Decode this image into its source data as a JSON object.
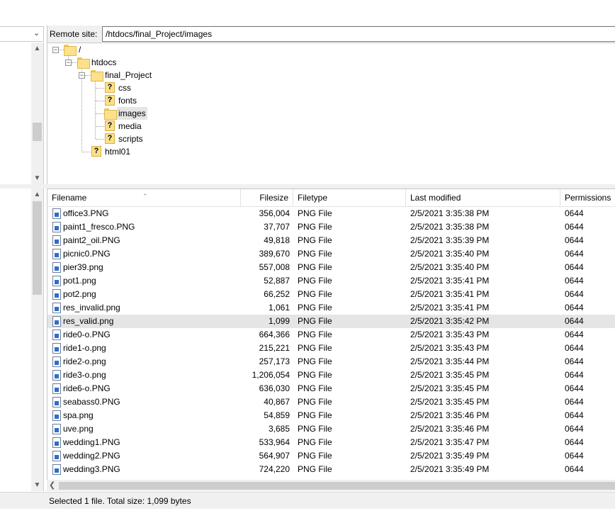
{
  "remote": {
    "label": "Remote site:",
    "path": "/htdocs/final_Project/images"
  },
  "tree": {
    "root": "/",
    "htdocs": "htdocs",
    "final_project": "final_Project",
    "children": [
      "css",
      "fonts",
      "images",
      "media",
      "scripts"
    ],
    "html01": "html01"
  },
  "columns": {
    "filename": "Filename",
    "filesize": "Filesize",
    "filetype": "Filetype",
    "modified": "Last modified",
    "permissions": "Permissions"
  },
  "files": [
    {
      "name": "office3.PNG",
      "size": "356,004",
      "type": "PNG File",
      "modified": "2/5/2021 3:35:38 PM",
      "perm": "0644"
    },
    {
      "name": "paint1_fresco.PNG",
      "size": "37,707",
      "type": "PNG File",
      "modified": "2/5/2021 3:35:38 PM",
      "perm": "0644"
    },
    {
      "name": "paint2_oil.PNG",
      "size": "49,818",
      "type": "PNG File",
      "modified": "2/5/2021 3:35:39 PM",
      "perm": "0644"
    },
    {
      "name": "picnic0.PNG",
      "size": "389,670",
      "type": "PNG File",
      "modified": "2/5/2021 3:35:40 PM",
      "perm": "0644"
    },
    {
      "name": "pier39.png",
      "size": "557,008",
      "type": "PNG File",
      "modified": "2/5/2021 3:35:40 PM",
      "perm": "0644"
    },
    {
      "name": "pot1.png",
      "size": "52,887",
      "type": "PNG File",
      "modified": "2/5/2021 3:35:41 PM",
      "perm": "0644"
    },
    {
      "name": "pot2.png",
      "size": "66,252",
      "type": "PNG File",
      "modified": "2/5/2021 3:35:41 PM",
      "perm": "0644"
    },
    {
      "name": "res_invalid.png",
      "size": "1,061",
      "type": "PNG File",
      "modified": "2/5/2021 3:35:41 PM",
      "perm": "0644"
    },
    {
      "name": "res_valid.png",
      "size": "1,099",
      "type": "PNG File",
      "modified": "2/5/2021 3:35:42 PM",
      "perm": "0644"
    },
    {
      "name": "ride0-o.PNG",
      "size": "664,366",
      "type": "PNG File",
      "modified": "2/5/2021 3:35:43 PM",
      "perm": "0644"
    },
    {
      "name": "ride1-o.png",
      "size": "215,221",
      "type": "PNG File",
      "modified": "2/5/2021 3:35:43 PM",
      "perm": "0644"
    },
    {
      "name": "ride2-o.png",
      "size": "257,173",
      "type": "PNG File",
      "modified": "2/5/2021 3:35:44 PM",
      "perm": "0644"
    },
    {
      "name": "ride3-o.png",
      "size": "1,206,054",
      "type": "PNG File",
      "modified": "2/5/2021 3:35:45 PM",
      "perm": "0644"
    },
    {
      "name": "ride6-o.PNG",
      "size": "636,030",
      "type": "PNG File",
      "modified": "2/5/2021 3:35:45 PM",
      "perm": "0644"
    },
    {
      "name": "seabass0.PNG",
      "size": "40,867",
      "type": "PNG File",
      "modified": "2/5/2021 3:35:45 PM",
      "perm": "0644"
    },
    {
      "name": "spa.png",
      "size": "54,859",
      "type": "PNG File",
      "modified": "2/5/2021 3:35:46 PM",
      "perm": "0644"
    },
    {
      "name": "uve.png",
      "size": "3,685",
      "type": "PNG File",
      "modified": "2/5/2021 3:35:46 PM",
      "perm": "0644"
    },
    {
      "name": "wedding1.PNG",
      "size": "533,964",
      "type": "PNG File",
      "modified": "2/5/2021 3:35:47 PM",
      "perm": "0644"
    },
    {
      "name": "wedding2.PNG",
      "size": "564,907",
      "type": "PNG File",
      "modified": "2/5/2021 3:35:49 PM",
      "perm": "0644"
    },
    {
      "name": "wedding3.PNG",
      "size": "724,220",
      "type": "PNG File",
      "modified": "2/5/2021 3:35:49 PM",
      "perm": "0644"
    }
  ],
  "selected_file": "res_valid.png",
  "status": {
    "text": "Selected 1 file. Total size: 1,099 bytes"
  },
  "icons": {
    "folder": "folder-icon",
    "unknown_folder": "question-folder-icon",
    "file": "png-file-icon"
  },
  "colors": {
    "selection": "#e5e5e5",
    "folder": "#fde08a",
    "panel": "#f0f0f0"
  }
}
